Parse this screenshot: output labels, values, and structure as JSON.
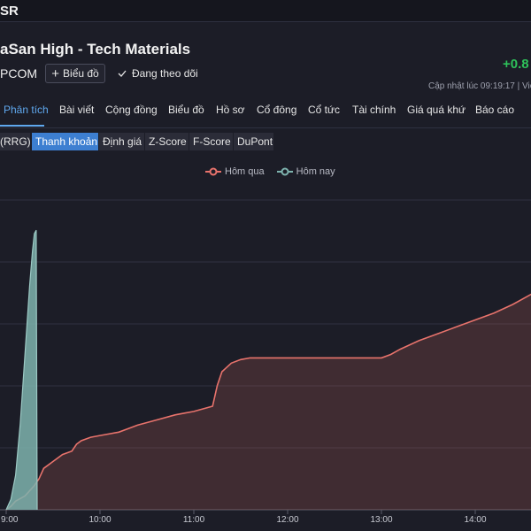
{
  "topbar": {
    "ticker_fragment": "SR"
  },
  "header": {
    "title": "aSan High - Tech Materials",
    "price_change": "+0.8",
    "exchange": "PCOM",
    "add_chart_label": "Biểu đồ",
    "follow_label": "Đang theo dõi",
    "updated_text": "Cập nhật lúc  09:19:17 | Việ"
  },
  "tabs": [
    {
      "label": "Phân tích",
      "active": true
    },
    {
      "label": "Bài viết"
    },
    {
      "label": "Cộng đồng"
    },
    {
      "label": "Biểu đồ"
    },
    {
      "label": "Hồ sơ"
    },
    {
      "label": "Cổ đông"
    },
    {
      "label": "Cổ tức"
    },
    {
      "label": "Tài chính"
    },
    {
      "label": "Giá quá khứ"
    },
    {
      "label": "Báo cáo"
    }
  ],
  "subtabs": [
    {
      "label": "(RRG)"
    },
    {
      "label": "Thanh khoản",
      "active": true
    },
    {
      "label": "Định giá"
    },
    {
      "label": "Z-Score"
    },
    {
      "label": "F-Score"
    },
    {
      "label": "DuPont"
    }
  ],
  "colors": {
    "yesterday": "#e8736c",
    "today": "#7eb3ae",
    "accent": "#3d7fd1",
    "positive": "#2ec25a"
  },
  "chart_data": {
    "type": "area",
    "x_ticks": [
      "9:00",
      "10:00",
      "11:00",
      "12:00",
      "13:00",
      "14:00"
    ],
    "legend": [
      "Hôm qua",
      "Hôm nay"
    ],
    "grid": true,
    "series": [
      {
        "name": "Hôm qua",
        "points": [
          [
            0,
            0.0
          ],
          [
            0.05,
            0.02
          ],
          [
            0.1,
            0.05
          ],
          [
            0.2,
            0.08
          ],
          [
            0.3,
            0.14
          ],
          [
            0.35,
            0.18
          ],
          [
            0.4,
            0.24
          ],
          [
            0.45,
            0.26
          ],
          [
            0.5,
            0.28
          ],
          [
            0.6,
            0.32
          ],
          [
            0.7,
            0.34
          ],
          [
            0.75,
            0.38
          ],
          [
            0.8,
            0.4
          ],
          [
            0.9,
            0.42
          ],
          [
            1.0,
            0.43
          ],
          [
            1.2,
            0.45
          ],
          [
            1.3,
            0.47
          ],
          [
            1.4,
            0.49
          ],
          [
            1.6,
            0.52
          ],
          [
            1.8,
            0.55
          ],
          [
            1.9,
            0.56
          ],
          [
            2.0,
            0.57
          ],
          [
            2.2,
            0.6
          ],
          [
            2.25,
            0.72
          ],
          [
            2.3,
            0.8
          ],
          [
            2.4,
            0.85
          ],
          [
            2.5,
            0.87
          ],
          [
            2.6,
            0.88
          ],
          [
            3.0,
            0.88
          ],
          [
            3.5,
            0.88
          ],
          [
            4.0,
            0.88
          ],
          [
            4.1,
            0.9
          ],
          [
            4.2,
            0.93
          ],
          [
            4.4,
            0.98
          ],
          [
            4.6,
            1.02
          ],
          [
            4.8,
            1.06
          ],
          [
            5.0,
            1.1
          ],
          [
            5.2,
            1.14
          ],
          [
            5.4,
            1.19
          ],
          [
            5.6,
            1.25
          ],
          [
            5.8,
            1.32
          ],
          [
            6.0,
            1.38
          ]
        ]
      },
      {
        "name": "Hôm nay",
        "points": [
          [
            0,
            0.0
          ],
          [
            0.05,
            0.06
          ],
          [
            0.1,
            0.2
          ],
          [
            0.15,
            0.5
          ],
          [
            0.2,
            0.9
          ],
          [
            0.25,
            1.3
          ],
          [
            0.28,
            1.5
          ],
          [
            0.3,
            1.6
          ],
          [
            0.32,
            1.62
          ],
          [
            0.33,
            0.0
          ]
        ]
      }
    ]
  }
}
